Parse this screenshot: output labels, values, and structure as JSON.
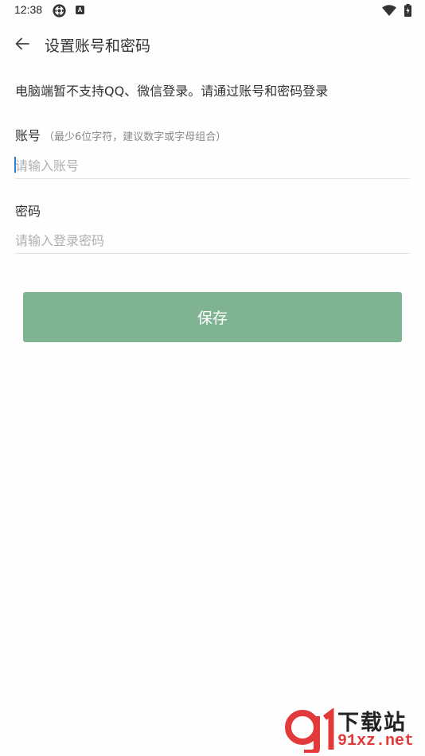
{
  "status_bar": {
    "time": "12:38",
    "icons": [
      "gear-icon",
      "a-badge-icon",
      "wifi-icon",
      "battery-charging-icon"
    ],
    "a_badge_text": "A"
  },
  "app_bar": {
    "title": "设置账号和密码",
    "back_icon": "arrow-left-icon"
  },
  "notice": "电脑端暂不支持QQ、微信登录。请通过账号和密码登录",
  "account": {
    "label": "账号",
    "hint": "（最少6位字符，建议数字或字母组合）",
    "placeholder": "请输入账号",
    "value": ""
  },
  "password": {
    "label": "密码",
    "placeholder": "请输入登录密码",
    "value": ""
  },
  "save_button": {
    "label": "保存",
    "color": "#7fb392"
  },
  "watermark": {
    "title": "下载站",
    "site": "91xz.net",
    "logo_color": "#e23a3a"
  }
}
